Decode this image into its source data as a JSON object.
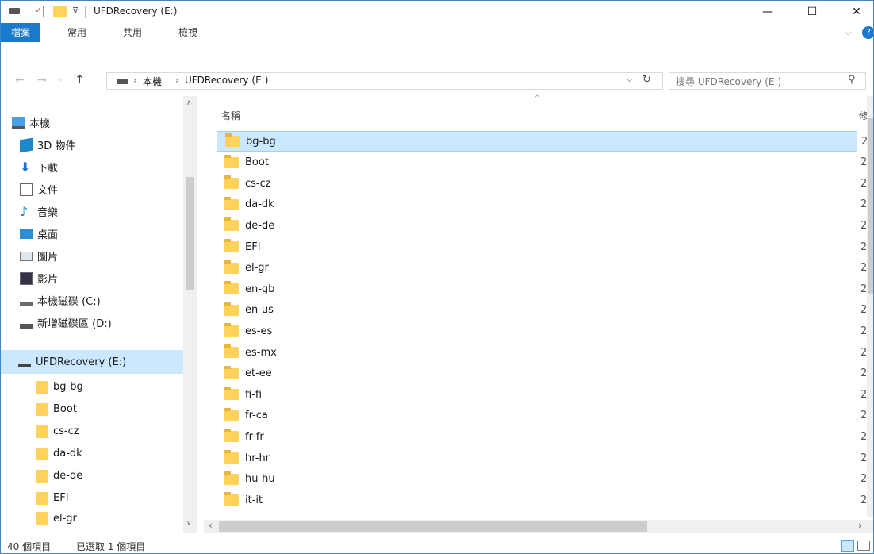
{
  "window": {
    "title": "UFDRecovery (E:)",
    "minimize_glyph": "—",
    "maximize_glyph": "☐",
    "close_glyph": "✕"
  },
  "ribbon": {
    "tabs": [
      "檔案",
      "常用",
      "共用",
      "檢視"
    ]
  },
  "address": {
    "root": "本機",
    "current": "UFDRecovery (E:)",
    "search_placeholder": "搜尋 UFDRecovery (E:)"
  },
  "nav": {
    "items": [
      {
        "label": "本機",
        "icon": "this-pc-icon"
      },
      {
        "label": "3D 物件",
        "icon": "3d-objects-icon"
      },
      {
        "label": "下載",
        "icon": "downloads-icon"
      },
      {
        "label": "文件",
        "icon": "documents-icon"
      },
      {
        "label": "音樂",
        "icon": "music-icon"
      },
      {
        "label": "桌面",
        "icon": "desktop-icon"
      },
      {
        "label": "圖片",
        "icon": "pictures-icon"
      },
      {
        "label": "影片",
        "icon": "videos-icon"
      },
      {
        "label": "本機磁碟 (C:)",
        "icon": "drive-icon"
      },
      {
        "label": "新增磁碟區 (D:)",
        "icon": "drive-icon"
      },
      {
        "label": "UFDRecovery (E:)",
        "icon": "usb-drive-icon"
      },
      {
        "label": "bg-bg",
        "icon": "folder-icon"
      },
      {
        "label": "Boot",
        "icon": "folder-icon"
      },
      {
        "label": "cs-cz",
        "icon": "folder-icon"
      },
      {
        "label": "da-dk",
        "icon": "folder-icon"
      },
      {
        "label": "de-de",
        "icon": "folder-icon"
      },
      {
        "label": "EFI",
        "icon": "folder-icon"
      },
      {
        "label": "el-gr",
        "icon": "folder-icon"
      }
    ],
    "selected": "UFDRecovery (E:)"
  },
  "list": {
    "column_name": "名稱",
    "date_fragment": "2",
    "items": [
      "bg-bg",
      "Boot",
      "cs-cz",
      "da-dk",
      "de-de",
      "EFI",
      "el-gr",
      "en-gb",
      "en-us",
      "es-es",
      "es-mx",
      "et-ee",
      "fi-fi",
      "fr-ca",
      "fr-fr",
      "hr-hr",
      "hu-hu",
      "it-it"
    ],
    "selected": "bg-bg"
  },
  "status": {
    "count": "40 個項目",
    "selection": "已選取 1 個項目"
  }
}
